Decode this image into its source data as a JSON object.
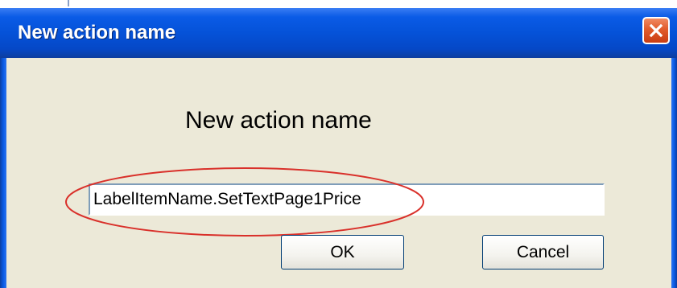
{
  "window": {
    "title": "New action name",
    "icons": {
      "close": "close-icon"
    }
  },
  "dialog": {
    "heading": "New action name",
    "action_name_value": "LabelItemName.SetTextPage1Price",
    "ok_label": "OK",
    "cancel_label": "Cancel"
  },
  "colors": {
    "titlebar": "#0552d8",
    "client_background": "#ece9d8",
    "close_button": "#e15b2b",
    "annotation_ellipse": "#d9302a"
  }
}
